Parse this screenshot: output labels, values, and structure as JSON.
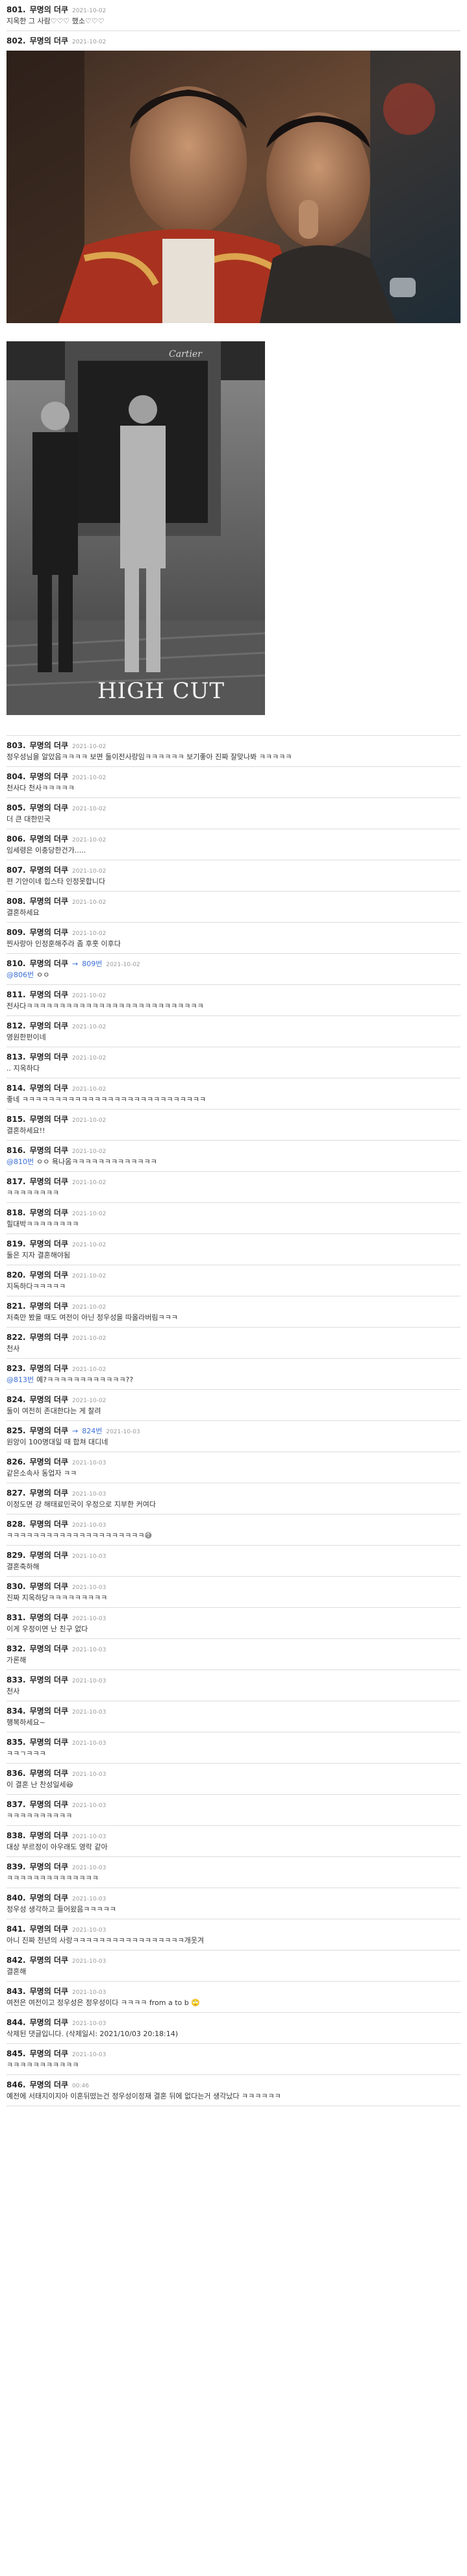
{
  "items": [
    {
      "num": "801.",
      "author": "무명의 더쿠",
      "date": "2021-10-02",
      "text": "지옥한 그 사람♡♡♡ 했소♡♡♡"
    },
    {
      "num": "802.",
      "author": "무명의 더쿠",
      "date": "2021-10-02",
      "text": "",
      "has_photos": true
    },
    {
      "num": "803.",
      "author": "무명의 더쿠",
      "date": "2021-10-02",
      "text": "정우성님을 알았음ㅋㅋㅋㅋ 보면 둘이전사랑임ㅋㅋㅋㅋㅋㅋ 보기좋아 진짜 잘맞나봐 ㅋㅋㅋㅋㅋ"
    },
    {
      "num": "804.",
      "author": "무명의 더쿠",
      "date": "2021-10-02",
      "text": "천사다 천사ㅋㅋㅋㅋㅋ"
    },
    {
      "num": "805.",
      "author": "무명의 더쿠",
      "date": "2021-10-02",
      "text": "더 큰 대한민국"
    },
    {
      "num": "806.",
      "author": "무명의 더쿠",
      "date": "2021-10-02",
      "text": "임세령은 이충당한건가....."
    },
    {
      "num": "807.",
      "author": "무명의 더쿠",
      "date": "2021-10-02",
      "text": "편 기안이네 힙스타 인정못합니다"
    },
    {
      "num": "808.",
      "author": "무명의 더쿠",
      "date": "2021-10-02",
      "text": "결혼하세요"
    },
    {
      "num": "809.",
      "author": "무명의 더쿠",
      "date": "2021-10-02",
      "text": "찐사랑아 인정훈해주라 좀 후훗 이후다"
    },
    {
      "num": "810.",
      "author": "무명의 더쿠",
      "reply": "809번",
      "date": "2021-10-02",
      "mention": "@806번",
      "text": "ㅇㅇ"
    },
    {
      "num": "811.",
      "author": "무명의 더쿠",
      "date": "2021-10-02",
      "text": "전사다ㅋㅋㅋㅋㅋㅋㅋㅋㅋㅋㅋㅋㅋㅋㅋㅋㅋㅋㅋㅋㅋㅋㅋㅋㅋㅋㅋ"
    },
    {
      "num": "812.",
      "author": "무명의 더쿠",
      "date": "2021-10-02",
      "text": "영원한펀이네"
    },
    {
      "num": "813.",
      "author": "무명의 더쿠",
      "date": "2021-10-02",
      "text": ".. 지옥하다"
    },
    {
      "num": "814.",
      "author": "무명의 더쿠",
      "date": "2021-10-02",
      "text": "좋네 ㅋㅋㅋㅋㅋㅋㅋㅋㅋㅋㅋㅋㅋㅋㅋㅋㅋㅋㅋㅋㅋㅋㅋㅋㅋㅋㅋㅋ"
    },
    {
      "num": "815.",
      "author": "무명의 더쿠",
      "date": "2021-10-02",
      "text": "결혼하세요!!"
    },
    {
      "num": "816.",
      "author": "무명의 더쿠",
      "date": "2021-10-02",
      "mention": "@810번",
      "text": "ㅇㅇ 욕나옴ㅋㅋㅋㅋㅋㅋㅋㅋㅋㅋㅋㅋㅋ"
    },
    {
      "num": "817.",
      "author": "무명의 더쿠",
      "date": "2021-10-02",
      "text": "ㅋㅋㅋㅋㅋㅋㅋㅋ"
    },
    {
      "num": "818.",
      "author": "무명의 더쿠",
      "date": "2021-10-02",
      "text": "힐대박ㅋㅋㅋㅋㅋㅋㅋㅋ"
    },
    {
      "num": "819.",
      "author": "무명의 더쿠",
      "date": "2021-10-02",
      "text": "둘은 지자 결혼해야됨"
    },
    {
      "num": "820.",
      "author": "무명의 더쿠",
      "date": "2021-10-02",
      "text": "지독하다ㅋㅋㅋㅋㅋ"
    },
    {
      "num": "821.",
      "author": "무명의 더쿠",
      "date": "2021-10-02",
      "text": "저축만 봤을 때도 여전이 아닌 정우성을 따올라버림ㅋㅋㅋ"
    },
    {
      "num": "822.",
      "author": "무명의 더쿠",
      "date": "2021-10-02",
      "text": "천사"
    },
    {
      "num": "823.",
      "author": "무명의 더쿠",
      "date": "2021-10-02",
      "mention": "@813번",
      "text": "예?ㅋㅋㅋㅋㅋㅋㅋㅋㅋㅋㅋㅋ??"
    },
    {
      "num": "824.",
      "author": "무명의 더쿠",
      "date": "2021-10-02",
      "text": "둘이 여전히 존대한다는 게 찰려"
    },
    {
      "num": "825.",
      "author": "무명의 더쿠",
      "reply": "824번",
      "date": "2021-10-03",
      "text": "원앙이 100명대일 때 합쳐 대디네"
    },
    {
      "num": "826.",
      "author": "무명의 더쿠",
      "date": "2021-10-03",
      "text": "같은소속사 동업자 ㅋㅋ"
    },
    {
      "num": "827.",
      "author": "무명의 더쿠",
      "date": "2021-10-03",
      "text": "이정도면 걍 해태료민국이 우정으로 지부한 커여다"
    },
    {
      "num": "828.",
      "author": "무명의 더쿠",
      "date": "2021-10-03",
      "text": "ㅋㅋㅋㅋㅋㅋㅋㅋㅋㅋㅋㅋㅋㅋㅋㅋㅋㅋㅋㅋㅋ😅"
    },
    {
      "num": "829.",
      "author": "무명의 더쿠",
      "date": "2021-10-03",
      "text": "결혼축하해"
    },
    {
      "num": "830.",
      "author": "무명의 더쿠",
      "date": "2021-10-03",
      "text": "진짜 지옥하당ㅋㅋㅋㅋㅋㅋㅋㅋㅋ"
    },
    {
      "num": "831.",
      "author": "무명의 더쿠",
      "date": "2021-10-03",
      "text": "이게 우정이면 난 친구 없다"
    },
    {
      "num": "832.",
      "author": "무명의 더쿠",
      "date": "2021-10-03",
      "text": "가론해"
    },
    {
      "num": "833.",
      "author": "무명의 더쿠",
      "date": "2021-10-03",
      "text": "천사"
    },
    {
      "num": "834.",
      "author": "무명의 더쿠",
      "date": "2021-10-03",
      "text": "행복하세요~"
    },
    {
      "num": "835.",
      "author": "무명의 더쿠",
      "date": "2021-10-03",
      "text": "ㅋㅋㄱㅋㅋㅋ"
    },
    {
      "num": "836.",
      "author": "무명의 더쿠",
      "date": "2021-10-03",
      "text": "이 결혼 난 찬성일세😆"
    },
    {
      "num": "837.",
      "author": "무명의 더쿠",
      "date": "2021-10-03",
      "text": "ㅋㅋㅋㅋㅋㅋㅋㅋㅋㅋ"
    },
    {
      "num": "838.",
      "author": "무명의 더쿠",
      "date": "2021-10-03",
      "text": "대상 부르정이 아우래도 영락 같아"
    },
    {
      "num": "839.",
      "author": "무명의 더쿠",
      "date": "2021-10-03",
      "text": "ㅋㅋㅋㅋㅋㅋㅋㅋㅋㅋㅋㅋㅋㅋ"
    },
    {
      "num": "840.",
      "author": "무명의 더쿠",
      "date": "2021-10-03",
      "text": "정우성 생각하고 들어왔음ㅋㅋㅋㅋㅋ"
    },
    {
      "num": "841.",
      "author": "무명의 더쿠",
      "date": "2021-10-03",
      "text": "아니 진짜 천년의 사랑ㅋㅋㅋㅋㅋㅋㅋㅋㅋㅋㅋㅋㅋㅋㅋㅋㅋ개웃겨"
    },
    {
      "num": "842.",
      "author": "무명의 더쿠",
      "date": "2021-10-03",
      "text": "결혼해"
    },
    {
      "num": "843.",
      "author": "무명의 더쿠",
      "date": "2021-10-03",
      "text": "여전은 여전이고 정우성은 정우성이다 ㅋㅋㅋㅋ from a to b 🙄"
    },
    {
      "num": "844.",
      "author": "무명의 더쿠",
      "date": "2021-10-03",
      "text": "삭제된 댓글입니다. (삭제일시: 2021/10/03 20:18:14)"
    },
    {
      "num": "845.",
      "author": "무명의 더쿠",
      "date": "2021-10-03",
      "text": "ㅋㅋㅋㅋㅋㅋㅋㅋㅋㅋㅋ"
    },
    {
      "num": "846.",
      "author": "무명의 더쿠",
      "date": "00:46",
      "text": "예전에 서태지이지아 이혼뒤떴는건 정우성이정재 결혼 뒤에 없다는거 생각났다 ㅋㅋㅋㅋㅋㅋ"
    }
  ],
  "photo2_caption": "HIGH CUT",
  "photo2_sign": "Cartier"
}
